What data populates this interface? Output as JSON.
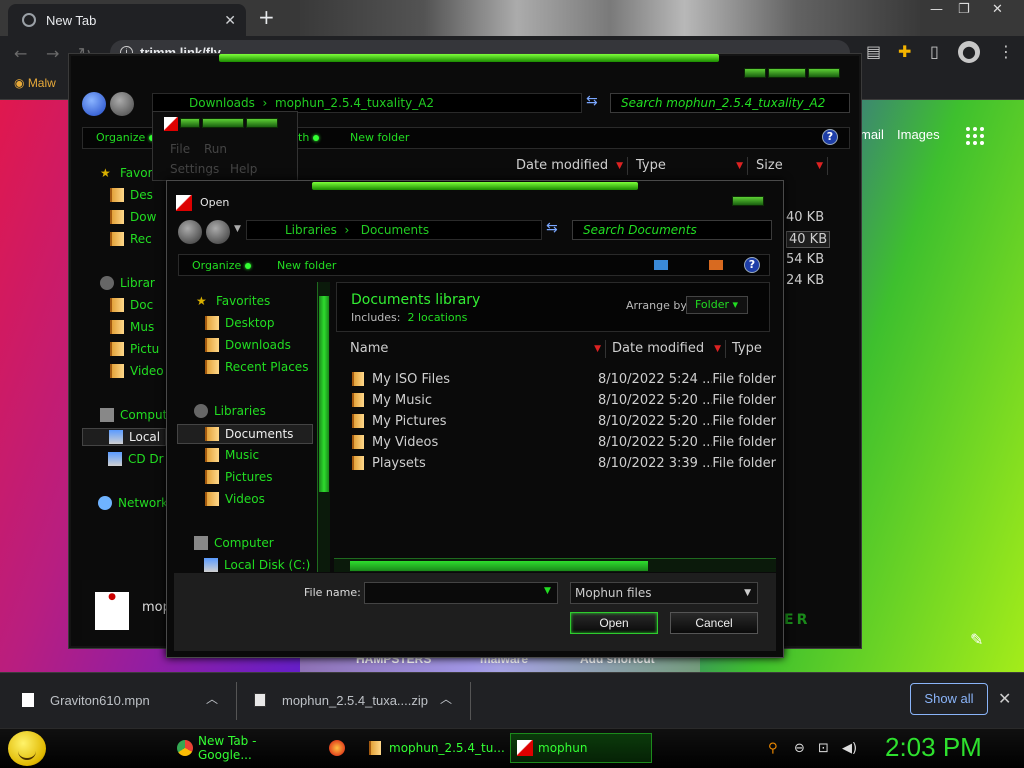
{
  "browser": {
    "tab_title": "New Tab",
    "address": "trimm.link/fly",
    "bookmark": "Malw",
    "page_links": {
      "gmail": "mail",
      "images": "Images"
    },
    "page_shortcuts": [
      "HAMPSTERS",
      "malware",
      "Add shortcut"
    ]
  },
  "explorer": {
    "address_crumbs": [
      "Downloads",
      "mophun_2.5.4_tuxality_A2"
    ],
    "search_placeholder": "Search mophun_2.5.4_tuxality_A2",
    "toolbar": {
      "organize": "Organize",
      "share": "th",
      "new_folder": "New folder"
    },
    "columns": {
      "date": "Date modified",
      "type": "Type",
      "size": "Size"
    },
    "tree": [
      "Favori",
      "Des",
      "Dow",
      "Rec",
      "Librar",
      "Doc",
      "Mus",
      "Pictu",
      "Video",
      "Comput",
      "Local",
      "CD Dr",
      "Network"
    ],
    "sizes": [
      "40 KB",
      "40 KB",
      "54 KB",
      "24 KB"
    ],
    "footer_label": "mop"
  },
  "mophun_menu": {
    "items": [
      "File",
      "Run",
      "Settings",
      "Help"
    ]
  },
  "dialog": {
    "title": "Open",
    "address_crumbs": [
      "Libraries",
      "Documents"
    ],
    "search_placeholder": "Search Documents",
    "toolbar": {
      "organize": "Organize",
      "new_folder": "New folder"
    },
    "nav": {
      "favorites": "Favorites",
      "desktop": "Desktop",
      "downloads": "Downloads",
      "recent": "Recent Places",
      "libraries": "Libraries",
      "documents": "Documents",
      "music": "Music",
      "pictures": "Pictures",
      "videos": "Videos",
      "computer": "Computer",
      "local_disk": "Local Disk (C:)"
    },
    "library": {
      "title": "Documents library",
      "includes_label": "Includes:",
      "includes_link": "2 locations",
      "arrange_label": "Arrange by:",
      "arrange_value": "Folder"
    },
    "columns": {
      "name": "Name",
      "date": "Date modified",
      "type": "Type"
    },
    "files": [
      {
        "name": "My ISO Files",
        "date": "8/10/2022 5:24 ...",
        "type": "File folder"
      },
      {
        "name": "My Music",
        "date": "8/10/2022 5:20 ...",
        "type": "File folder"
      },
      {
        "name": "My Pictures",
        "date": "8/10/2022 5:20 ...",
        "type": "File folder"
      },
      {
        "name": "My Videos",
        "date": "8/10/2022 5:20 ...",
        "type": "File folder"
      },
      {
        "name": "Playsets",
        "date": "8/10/2022 3:39 ...",
        "type": "File folder"
      }
    ],
    "file_name_label": "File name:",
    "file_name_value": "",
    "file_type": "Mophun files",
    "open_button": "Open",
    "cancel_button": "Cancel"
  },
  "downloads": {
    "items": [
      "Graviton610.mpn",
      "mophun_2.5.4_tuxa....zip"
    ],
    "show_all": "Show all"
  },
  "taskbar": {
    "items": [
      "New Tab - Google...",
      "mophun_2.5.4_tu...",
      "mophun"
    ],
    "clock": "2:03 PM"
  },
  "colors": {
    "accent_green": "#33ee33",
    "chrome_dark": "#202124",
    "link_blue": "#8ab4f8"
  }
}
